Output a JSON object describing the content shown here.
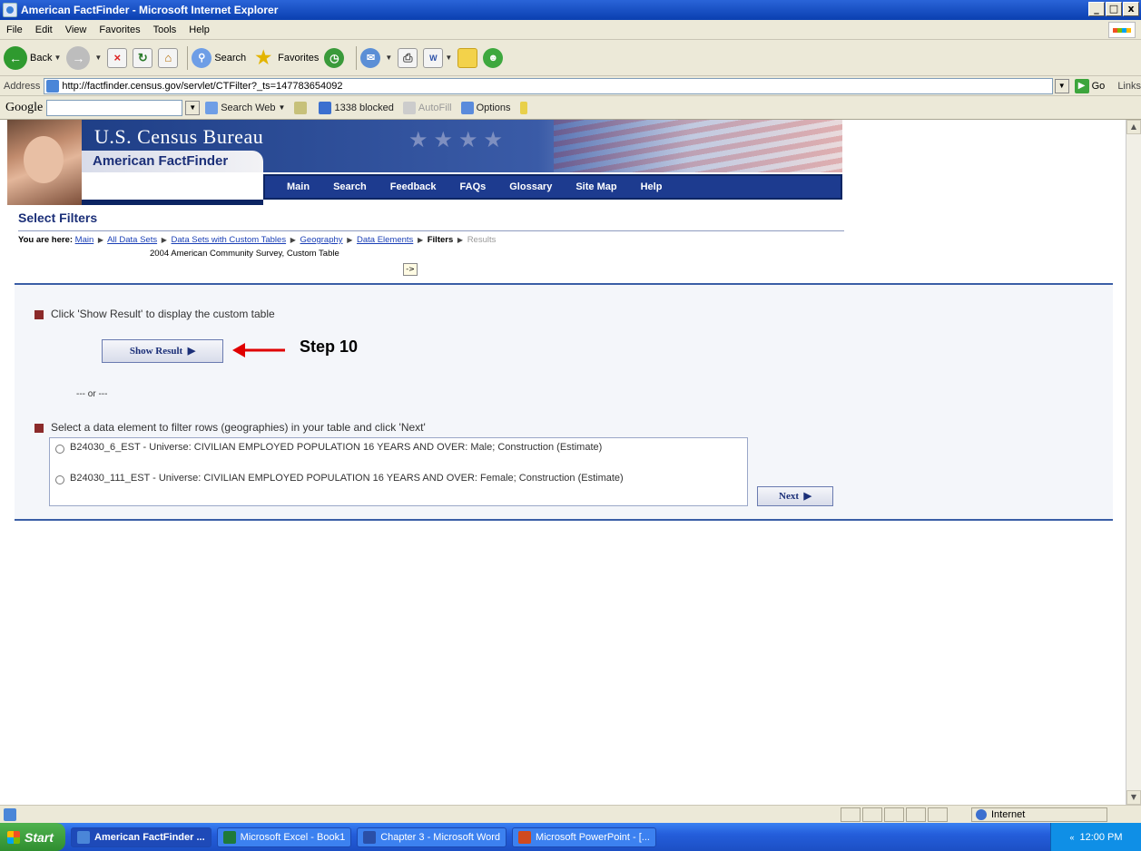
{
  "window": {
    "title": "American FactFinder - Microsoft Internet Explorer",
    "minimize": "_",
    "maximize": "□",
    "close": "x"
  },
  "menu": [
    "File",
    "Edit",
    "View",
    "Favorites",
    "Tools",
    "Help"
  ],
  "toolbar": {
    "back_label": "Back",
    "search_label": "Search",
    "favorites_label": "Favorites"
  },
  "address": {
    "label": "Address",
    "url": "http://factfinder.census.gov/servlet/CTFilter?_ts=147783654092",
    "go_label": "Go",
    "links_label": "Links"
  },
  "google_bar": {
    "logo": "Google",
    "search_web": "Search Web",
    "blocked": "1338 blocked",
    "autofill": "AutoFill",
    "options": "Options"
  },
  "header": {
    "bureau": "U.S. Census Bureau",
    "product": "American FactFinder",
    "nav": [
      "Main",
      "Search",
      "Feedback",
      "FAQs",
      "Glossary",
      "Site Map",
      "Help"
    ]
  },
  "page": {
    "title": "Select Filters",
    "breadcrumb": {
      "prefix": "You are here:",
      "links": [
        "Main",
        "All Data Sets",
        "Data Sets with Custom Tables",
        "Geography",
        "Data Elements"
      ],
      "current": "Filters",
      "next": "Results",
      "dataset": "2004 American Community Survey, Custom Table"
    },
    "instruction_show": "Click 'Show Result' to display the custom table",
    "show_result_label": "Show Result",
    "annotation": "Step 10",
    "or_text": "--- or ---",
    "instruction_filter": "Select a data element to filter rows (geographies) in your table and click 'Next'",
    "options": [
      "B24030_6_EST - Universe: CIVILIAN EMPLOYED POPULATION 16 YEARS AND OVER: Male; Construction (Estimate)",
      "B24030_111_EST - Universe: CIVILIAN EMPLOYED POPULATION 16 YEARS AND OVER: Female; Construction (Estimate)"
    ],
    "next_label": "Next"
  },
  "status": {
    "zone": "Internet"
  },
  "taskbar": {
    "start": "Start",
    "tasks": [
      "American FactFinder ...",
      "Microsoft Excel - Book1",
      "Chapter 3 - Microsoft Word",
      "Microsoft PowerPoint - [..."
    ],
    "clock": "12:00 PM"
  },
  "colors": {
    "title_bar": "#0a3fb0",
    "nav_bar": "#1d3b8f",
    "bullet": "#8b2a2a",
    "annotation_arrow": "#e00000",
    "link": "#1a3fb6"
  }
}
